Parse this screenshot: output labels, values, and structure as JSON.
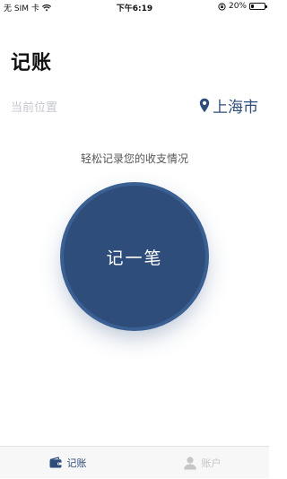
{
  "status_bar": {
    "carrier": "无 SIM 卡",
    "time": "下午6:19",
    "battery_percent": "20%",
    "battery_level": 0.2
  },
  "page": {
    "title": "记账"
  },
  "location": {
    "label": "当前位置",
    "city": "上海市"
  },
  "main": {
    "tagline": "轻松记录您的收支情况",
    "record_button_label": "记一笔"
  },
  "tab_bar": {
    "tabs": [
      {
        "label": "记账",
        "active": true
      },
      {
        "label": "账户",
        "active": false
      }
    ]
  },
  "colors": {
    "accent": "#2f4d7a",
    "inactive": "#c6c6c6"
  }
}
